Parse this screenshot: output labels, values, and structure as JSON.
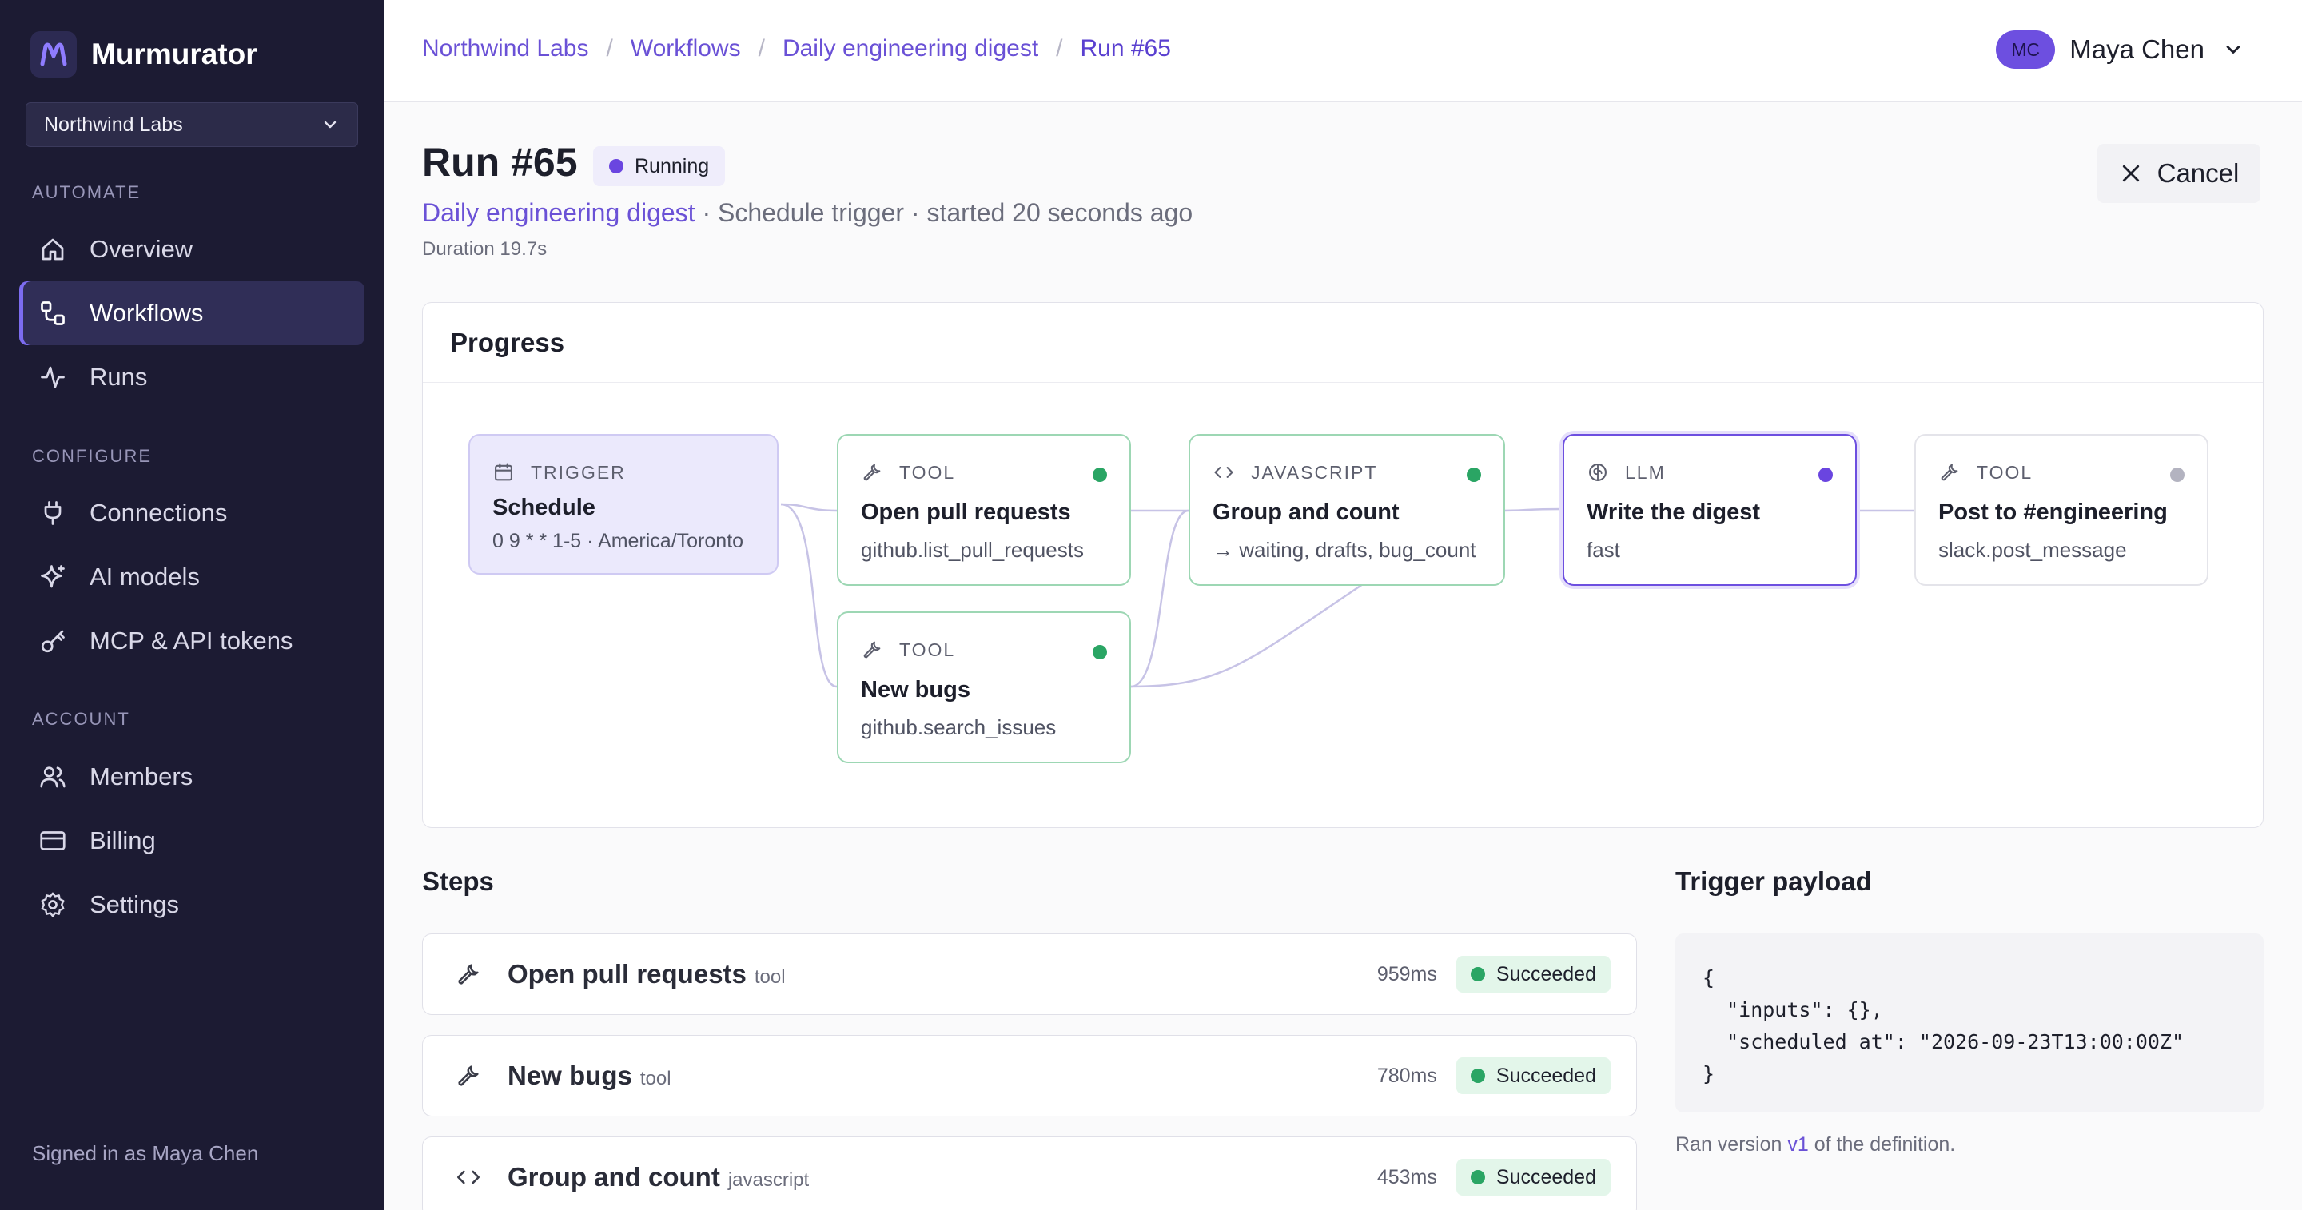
{
  "app": {
    "name": "Murmurator",
    "org": "Northwind Labs",
    "signed_in": "Signed in as Maya Chen"
  },
  "nav": {
    "sections": {
      "automate": "AUTOMATE",
      "configure": "CONFIGURE",
      "account": "ACCOUNT"
    },
    "items": [
      {
        "label": "Overview",
        "icon": "home-icon"
      },
      {
        "label": "Workflows",
        "icon": "workflow-icon",
        "active": true
      },
      {
        "label": "Runs",
        "icon": "activity-icon"
      },
      {
        "label": "Connections",
        "icon": "plug-icon"
      },
      {
        "label": "AI models",
        "icon": "sparkle-icon"
      },
      {
        "label": "MCP & API tokens",
        "icon": "key-icon"
      },
      {
        "label": "Members",
        "icon": "users-icon"
      },
      {
        "label": "Billing",
        "icon": "credit-card-icon"
      },
      {
        "label": "Settings",
        "icon": "gear-icon"
      }
    ]
  },
  "breadcrumb": [
    "Northwind Labs",
    "Workflows",
    "Daily engineering digest",
    "Run #65"
  ],
  "user": {
    "initials": "MC",
    "name": "Maya Chen"
  },
  "run": {
    "title": "Run #65",
    "status": "Running",
    "workflow": "Daily engineering digest",
    "trigger_meta": " · Schedule trigger · started 20 seconds ago",
    "duration": "Duration 19.7s",
    "cancel_label": "Cancel"
  },
  "progress": {
    "title": "Progress",
    "nodes": [
      {
        "kind": "TRIGGER",
        "title": "Schedule",
        "sub": "0 9 * * 1-5 · America/Toronto"
      },
      {
        "kind": "TOOL",
        "title": "Open pull requests",
        "sub": "github.list_pull_requests",
        "state": "success"
      },
      {
        "kind": "TOOL",
        "title": "New bugs",
        "sub": "github.search_issues",
        "state": "success"
      },
      {
        "kind": "JAVASCRIPT",
        "title": "Group and count",
        "sub": "→ waiting, drafts, bug_count",
        "state": "success"
      },
      {
        "kind": "LLM",
        "title": "Write the digest",
        "sub": "fast",
        "state": "running"
      },
      {
        "kind": "TOOL",
        "title": "Post to #engineering",
        "sub": "slack.post_message",
        "state": "pending"
      }
    ],
    "colors": {
      "success": "#2aa564",
      "running": "#6a45e0",
      "pending": "#b3b3c0"
    }
  },
  "steps": {
    "title": "Steps",
    "rows": [
      {
        "name": "Open pull requests",
        "kind": "tool",
        "duration": "959ms",
        "status": "Succeeded"
      },
      {
        "name": "New bugs",
        "kind": "tool",
        "duration": "780ms",
        "status": "Succeeded"
      },
      {
        "name": "Group and count",
        "kind": "javascript",
        "duration": "453ms",
        "status": "Succeeded"
      }
    ]
  },
  "payload": {
    "title": "Trigger payload",
    "json": "{\n  \"inputs\": {},\n  \"scheduled_at\": \"2026-09-23T13:00:00Z\"\n}",
    "ran_prefix": "Ran version ",
    "version": "v1",
    "ran_suffix": " of the definition."
  }
}
